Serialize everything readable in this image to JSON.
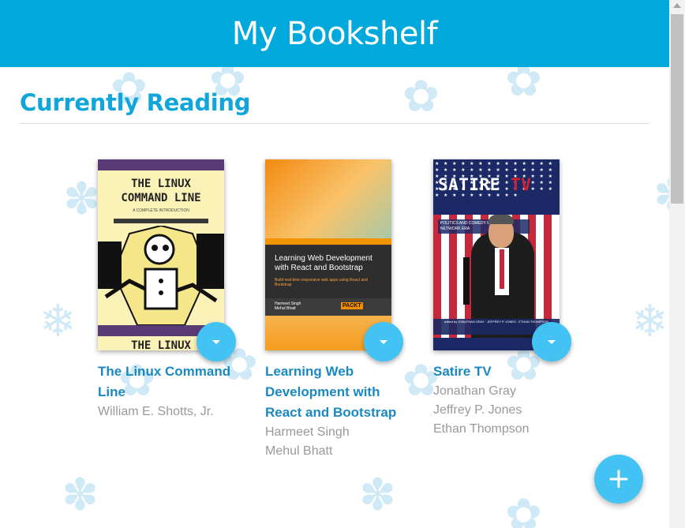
{
  "app": {
    "title": "My Bookshelf"
  },
  "shelf": {
    "title": "Currently Reading",
    "books": [
      {
        "title": "The Linux Command Line",
        "authors": [
          "William E. Shotts, Jr."
        ],
        "cover": {
          "title_line1": "THE LINUX",
          "title_line2": "COMMAND LINE",
          "subtitle": "A COMPLETE INTRODUCTION",
          "bottom_text": "THE LINUX"
        }
      },
      {
        "title": "Learning Web Development with React and Bootstrap",
        "authors": [
          "Harmeet Singh",
          "Mehul Bhatt"
        ],
        "cover": {
          "title": "Learning Web Development with React and Bootstrap",
          "subtitle": "Build real-time responsive web apps using React and Bootstrap",
          "authors": "Harmeet Singh\nMehul Bhatt",
          "publisher": "PACKT"
        }
      },
      {
        "title": "Satire TV",
        "authors": [
          "Jonathan Gray",
          "Jeffrey P. Jones",
          "Ethan Thompson"
        ],
        "cover": {
          "title_word1": "SATIRE",
          "title_word2": "TV",
          "subtitle": "POLITICS AND COMEDY IN THE POST-NETWORK ERA",
          "credits": "edited by JONATHAN GRAY · JEFFREY P. JONES · ETHAN THOMPSON"
        }
      }
    ]
  },
  "add_button": {
    "label": "+"
  },
  "colors": {
    "header": "#00a8dc",
    "section_title": "#11a6d9",
    "book_title": "#1a89c1",
    "author": "#999999",
    "fab": "#43c3f3"
  },
  "icons": {
    "shelf_changer": "caret-down-icon",
    "add": "plus-icon",
    "background": "leaf-icon"
  }
}
